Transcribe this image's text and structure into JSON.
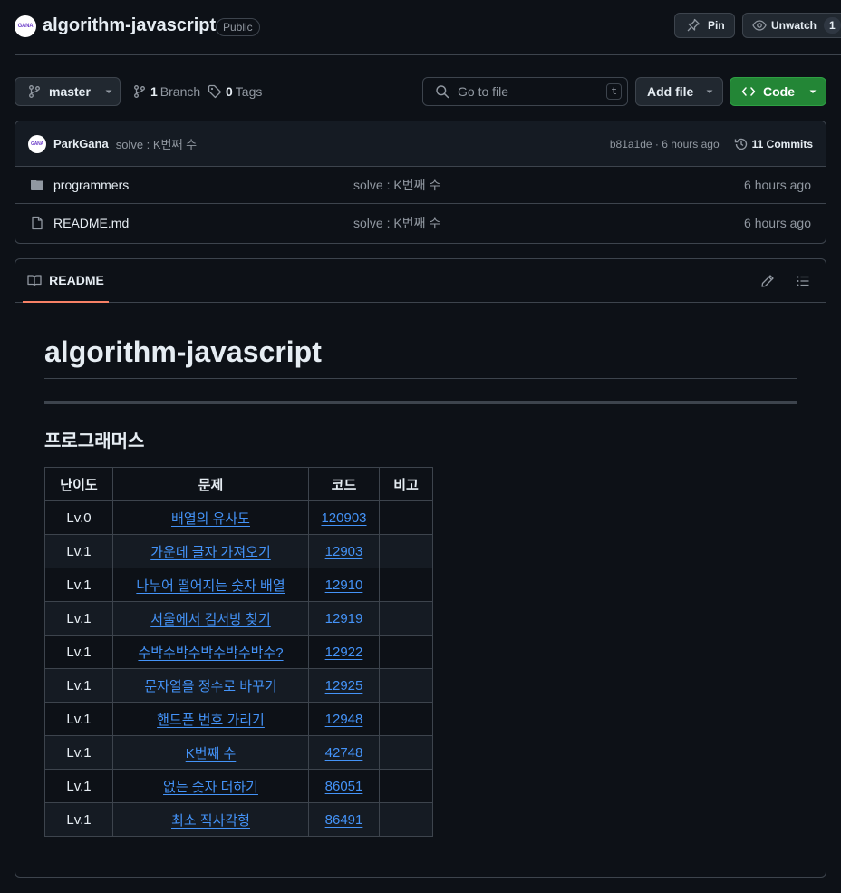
{
  "header": {
    "avatar_text": "GANA",
    "repo_name": "algorithm-javascript",
    "visibility": "Public",
    "pin_label": "Pin",
    "unwatch_label": "Unwatch",
    "watch_count": "1"
  },
  "toolbar": {
    "branch": "master",
    "branch_count": "1",
    "branch_label": "Branch",
    "tag_count": "0",
    "tag_label": "Tags",
    "search_placeholder": "Go to file",
    "search_shortcut": "t",
    "add_file_label": "Add file",
    "code_label": "Code"
  },
  "latest_commit": {
    "avatar_text": "GANA",
    "author": "ParkGana",
    "message": "solve : K번째 수",
    "hash_time": "b81a1de · 6 hours ago",
    "commits_label": "11 Commits"
  },
  "files": [
    {
      "name": "programmers",
      "type": "folder",
      "message": "solve : K번째 수",
      "time": "6 hours ago"
    },
    {
      "name": "README.md",
      "type": "file",
      "message": "solve : K번째 수",
      "time": "6 hours ago"
    }
  ],
  "readme": {
    "tab_label": "README",
    "title": "algorithm-javascript",
    "section_title": "프로그래머스",
    "table_headers": [
      "난이도",
      "문제",
      "코드",
      "비고"
    ],
    "rows": [
      {
        "level": "Lv.0",
        "problem": "배열의 유사도",
        "code": "120903",
        "note": ""
      },
      {
        "level": "Lv.1",
        "problem": "가운데 글자 가져오기",
        "code": "12903",
        "note": ""
      },
      {
        "level": "Lv.1",
        "problem": "나누어 떨어지는 숫자 배열",
        "code": "12910",
        "note": ""
      },
      {
        "level": "Lv.1",
        "problem": "서울에서 김서방 찾기",
        "code": "12919",
        "note": ""
      },
      {
        "level": "Lv.1",
        "problem": "수박수박수박수박수박수?",
        "code": "12922",
        "note": ""
      },
      {
        "level": "Lv.1",
        "problem": "문자열을 정수로 바꾸기",
        "code": "12925",
        "note": ""
      },
      {
        "level": "Lv.1",
        "problem": "핸드폰 번호 가리기",
        "code": "12948",
        "note": ""
      },
      {
        "level": "Lv.1",
        "problem": "K번째 수",
        "code": "42748",
        "note": ""
      },
      {
        "level": "Lv.1",
        "problem": "없는 숫자 더하기",
        "code": "86051",
        "note": ""
      },
      {
        "level": "Lv.1",
        "problem": "최소 직사각형",
        "code": "86491",
        "note": ""
      }
    ]
  }
}
